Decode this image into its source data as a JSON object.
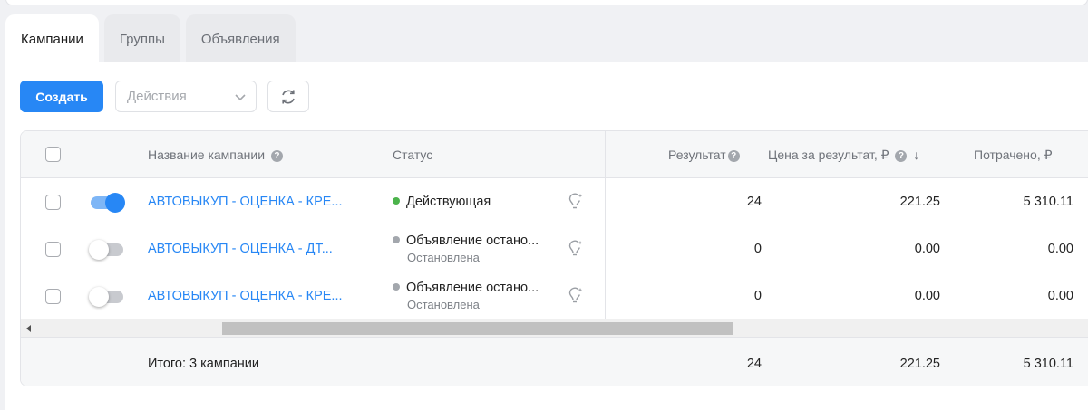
{
  "tabs": [
    {
      "label": "Кампании",
      "active": true
    },
    {
      "label": "Группы",
      "active": false
    },
    {
      "label": "Объявления",
      "active": false
    }
  ],
  "toolbar": {
    "create_label": "Создать",
    "actions_placeholder": "Действия"
  },
  "table": {
    "headers": {
      "name": "Название кампании",
      "status": "Статус",
      "result": "Результат",
      "price": "Цена за результат, ₽",
      "price_sort": "↓",
      "spent": "Потрачено, ₽"
    },
    "rows": [
      {
        "enabled": true,
        "name": "АВТОВЫКУП - ОЦЕНКА - КРЕ...",
        "status": "Действующая",
        "status_sub": "",
        "status_color": "#4bb34b",
        "result": "24",
        "price": "221.25",
        "spent": "5 310.11"
      },
      {
        "enabled": false,
        "name": "АВТОВЫКУП - ОЦЕНКА - ДТ...",
        "status": "Объявление остано...",
        "status_sub": "Остановлена",
        "status_color": "#a3a7ad",
        "result": "0",
        "price": "0.00",
        "spent": "0.00"
      },
      {
        "enabled": false,
        "name": "АВТОВЫКУП - ОЦЕНКА - КРЕ...",
        "status": "Объявление остано...",
        "status_sub": "Остановлена",
        "status_color": "#a3a7ad",
        "result": "0",
        "price": "0.00",
        "spent": "0.00"
      }
    ],
    "footer": {
      "label": "Итого: 3 кампании",
      "result": "24",
      "price": "221.25",
      "spent": "5 310.11"
    }
  },
  "colors": {
    "accent": "#2787f5",
    "active_status": "#4bb34b",
    "stopped_status": "#a3a7ad"
  }
}
